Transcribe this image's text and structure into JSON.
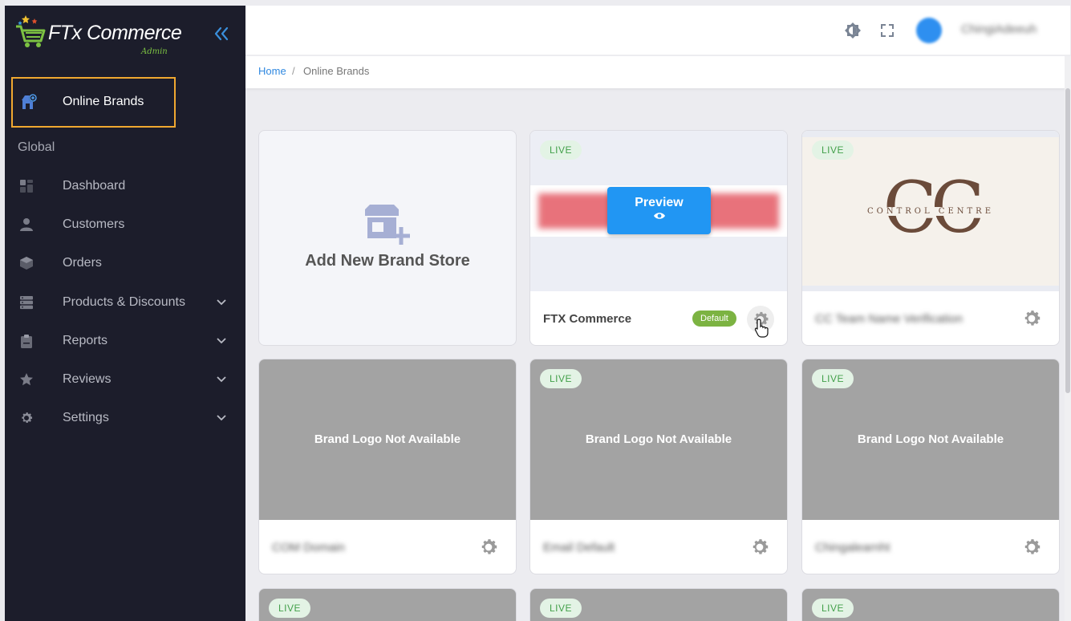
{
  "app": {
    "logo_text": "FTx Commerce",
    "logo_sub": "Admin"
  },
  "sidebar": {
    "active_item": {
      "label": "Online Brands",
      "icon": "store-icon"
    },
    "section_title": "Global",
    "items": [
      {
        "label": "Dashboard",
        "icon": "dashboard-icon",
        "expandable": false
      },
      {
        "label": "Customers",
        "icon": "user-icon",
        "expandable": false
      },
      {
        "label": "Orders",
        "icon": "box-icon",
        "expandable": false
      },
      {
        "label": "Products & Discounts",
        "icon": "server-icon",
        "expandable": true
      },
      {
        "label": "Reports",
        "icon": "clipboard-icon",
        "expandable": true
      },
      {
        "label": "Reviews",
        "icon": "star-icon",
        "expandable": true
      },
      {
        "label": "Settings",
        "icon": "gear-icon",
        "expandable": true
      }
    ]
  },
  "topbar": {
    "username": "ChingiAdeeuh"
  },
  "breadcrumb": {
    "home": "Home",
    "separator": "/",
    "current": "Online Brands"
  },
  "cards": {
    "add_new": "Add New Brand Store",
    "live_label": "LIVE",
    "preview_label": "Preview",
    "default_badge": "Default",
    "no_logo_text": "Brand Logo Not Available",
    "brands": [
      {
        "name": "FTX Commerce",
        "live": true,
        "default": true,
        "logo": "banner"
      },
      {
        "name": "CC Team Name Verification",
        "live": true,
        "default": false,
        "logo": "control-centre"
      },
      {
        "name": "COM Domain",
        "live": false,
        "default": false,
        "logo": "none"
      },
      {
        "name": "Email Default",
        "live": true,
        "default": false,
        "logo": "none"
      },
      {
        "name": "Chingalearnht",
        "live": true,
        "default": false,
        "logo": "none"
      }
    ],
    "cc_logo": {
      "letters": "CC",
      "text": "CONTROL CENTRE"
    }
  },
  "colors": {
    "sidebar_bg": "#1c1d2b",
    "accent": "#2196f3",
    "active_outline": "#f0a830",
    "live_green": "#43a04a",
    "default_badge": "#7cb342",
    "placeholder_gray": "#a3a3a3"
  }
}
